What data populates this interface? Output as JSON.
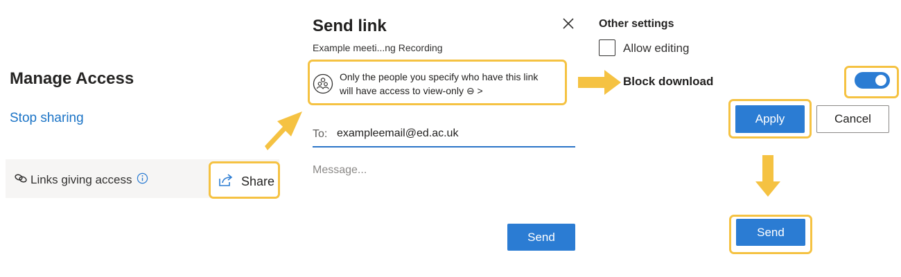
{
  "colors": {
    "highlight": "#f5c242",
    "accent": "#2b7cd3",
    "link": "#1a73c6",
    "arrow": "#f5c242"
  },
  "manage_access": {
    "title": "Manage Access",
    "stop_sharing": "Stop sharing",
    "links_giving_access": "Links giving access",
    "share_label": "Share",
    "icons": [
      "link-icon",
      "info-icon",
      "share-icon"
    ]
  },
  "send_link": {
    "title": "Send link",
    "subtitle": "Example meeti...ng Recording",
    "permission_line1": "Only the people you specify who have this link",
    "permission_line2": "will have access to view-only ⊖ >",
    "to_label": "To:",
    "to_value": "exampleemail@ed.ac.uk",
    "message_placeholder": "Message...",
    "send_label": "Send",
    "icons": [
      "close-icon",
      "people-icon"
    ]
  },
  "other_settings": {
    "title": "Other settings",
    "allow_editing": "Allow editing",
    "allow_editing_checked": false,
    "block_download": "Block download",
    "block_download_on": true,
    "apply_label": "Apply",
    "cancel_label": "Cancel",
    "send_label": "Send"
  }
}
